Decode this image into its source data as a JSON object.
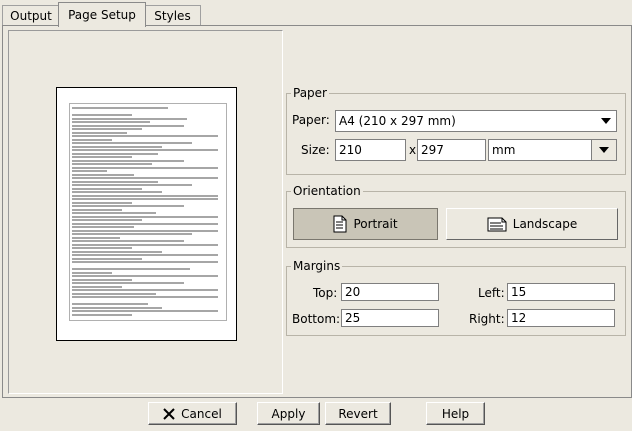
{
  "tabs": [
    {
      "label": "Output"
    },
    {
      "label": "Page Setup"
    },
    {
      "label": "Styles"
    }
  ],
  "paper": {
    "group_title": "Paper",
    "paper_label": "Paper:",
    "paper_value": "A4 (210 x 297 mm)",
    "size_label": "Size:",
    "width_value": "210",
    "times": "x",
    "height_value": "297",
    "unit_value": "mm"
  },
  "orientation": {
    "group_title": "Orientation",
    "portrait_label": "Portrait",
    "landscape_label": "Landscape",
    "selected": "Portrait"
  },
  "margins": {
    "group_title": "Margins",
    "top_label": "Top:",
    "top_value": "20",
    "left_label": "Left:",
    "left_value": "15",
    "bottom_label": "Bottom:",
    "bottom_value": "25",
    "right_label": "Right:",
    "right_value": "12"
  },
  "buttons": {
    "cancel": "Cancel",
    "apply": "Apply",
    "revert": "Revert",
    "help": "Help"
  },
  "icons": {
    "cancel": "x-icon",
    "portrait": "portrait-page-icon",
    "landscape": "landscape-page-icon",
    "dropdown": "chevron-down-icon"
  }
}
